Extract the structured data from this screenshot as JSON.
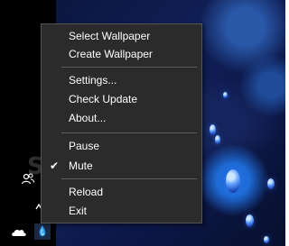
{
  "watermark": "SOFTPEDIA",
  "menu": {
    "items": [
      {
        "label": "Select Wallpaper",
        "checked": false
      },
      {
        "label": "Create Wallpaper",
        "checked": false
      },
      {
        "label": "Settings...",
        "checked": false
      },
      {
        "label": "Check Update",
        "checked": false
      },
      {
        "label": "About...",
        "checked": false
      },
      {
        "label": "Pause",
        "checked": false
      },
      {
        "label": "Mute",
        "checked": true
      },
      {
        "label": "Reload",
        "checked": false
      },
      {
        "label": "Exit",
        "checked": false
      }
    ],
    "checkmark": "✔"
  },
  "tray": {
    "icons": [
      "people-icon",
      "onedrive-cloud-icon",
      "chevron-up-icon",
      "app-tray-icon"
    ]
  },
  "colors": {
    "menu_bg": "#2b2b2b",
    "menu_text": "#ffffff",
    "desktop_blue": "#101f57",
    "accent_blue": "#1f6cd8"
  }
}
